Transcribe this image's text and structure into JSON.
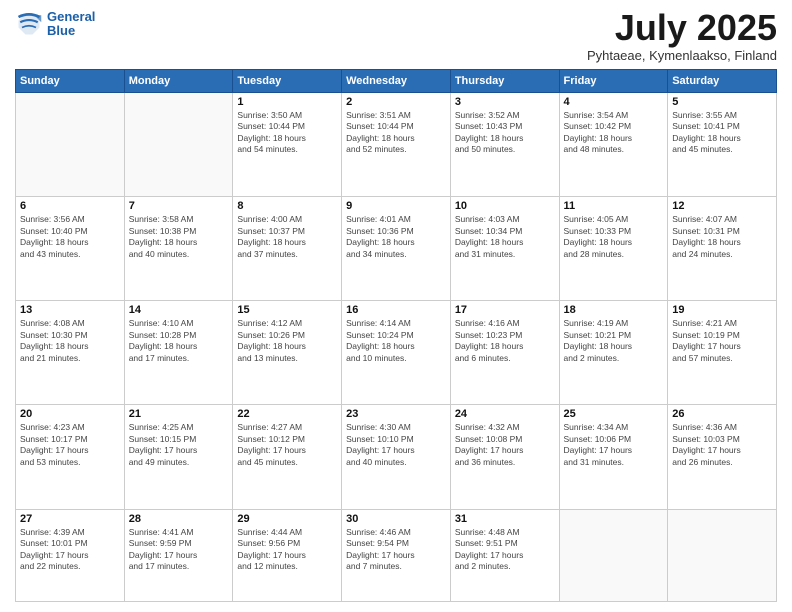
{
  "header": {
    "logo_line1": "General",
    "logo_line2": "Blue",
    "month_title": "July 2025",
    "location": "Pyhtaeae, Kymenlaakso, Finland"
  },
  "weekdays": [
    "Sunday",
    "Monday",
    "Tuesday",
    "Wednesday",
    "Thursday",
    "Friday",
    "Saturday"
  ],
  "weeks": [
    [
      {
        "day": "",
        "info": ""
      },
      {
        "day": "",
        "info": ""
      },
      {
        "day": "1",
        "info": "Sunrise: 3:50 AM\nSunset: 10:44 PM\nDaylight: 18 hours\nand 54 minutes."
      },
      {
        "day": "2",
        "info": "Sunrise: 3:51 AM\nSunset: 10:44 PM\nDaylight: 18 hours\nand 52 minutes."
      },
      {
        "day": "3",
        "info": "Sunrise: 3:52 AM\nSunset: 10:43 PM\nDaylight: 18 hours\nand 50 minutes."
      },
      {
        "day": "4",
        "info": "Sunrise: 3:54 AM\nSunset: 10:42 PM\nDaylight: 18 hours\nand 48 minutes."
      },
      {
        "day": "5",
        "info": "Sunrise: 3:55 AM\nSunset: 10:41 PM\nDaylight: 18 hours\nand 45 minutes."
      }
    ],
    [
      {
        "day": "6",
        "info": "Sunrise: 3:56 AM\nSunset: 10:40 PM\nDaylight: 18 hours\nand 43 minutes."
      },
      {
        "day": "7",
        "info": "Sunrise: 3:58 AM\nSunset: 10:38 PM\nDaylight: 18 hours\nand 40 minutes."
      },
      {
        "day": "8",
        "info": "Sunrise: 4:00 AM\nSunset: 10:37 PM\nDaylight: 18 hours\nand 37 minutes."
      },
      {
        "day": "9",
        "info": "Sunrise: 4:01 AM\nSunset: 10:36 PM\nDaylight: 18 hours\nand 34 minutes."
      },
      {
        "day": "10",
        "info": "Sunrise: 4:03 AM\nSunset: 10:34 PM\nDaylight: 18 hours\nand 31 minutes."
      },
      {
        "day": "11",
        "info": "Sunrise: 4:05 AM\nSunset: 10:33 PM\nDaylight: 18 hours\nand 28 minutes."
      },
      {
        "day": "12",
        "info": "Sunrise: 4:07 AM\nSunset: 10:31 PM\nDaylight: 18 hours\nand 24 minutes."
      }
    ],
    [
      {
        "day": "13",
        "info": "Sunrise: 4:08 AM\nSunset: 10:30 PM\nDaylight: 18 hours\nand 21 minutes."
      },
      {
        "day": "14",
        "info": "Sunrise: 4:10 AM\nSunset: 10:28 PM\nDaylight: 18 hours\nand 17 minutes."
      },
      {
        "day": "15",
        "info": "Sunrise: 4:12 AM\nSunset: 10:26 PM\nDaylight: 18 hours\nand 13 minutes."
      },
      {
        "day": "16",
        "info": "Sunrise: 4:14 AM\nSunset: 10:24 PM\nDaylight: 18 hours\nand 10 minutes."
      },
      {
        "day": "17",
        "info": "Sunrise: 4:16 AM\nSunset: 10:23 PM\nDaylight: 18 hours\nand 6 minutes."
      },
      {
        "day": "18",
        "info": "Sunrise: 4:19 AM\nSunset: 10:21 PM\nDaylight: 18 hours\nand 2 minutes."
      },
      {
        "day": "19",
        "info": "Sunrise: 4:21 AM\nSunset: 10:19 PM\nDaylight: 17 hours\nand 57 minutes."
      }
    ],
    [
      {
        "day": "20",
        "info": "Sunrise: 4:23 AM\nSunset: 10:17 PM\nDaylight: 17 hours\nand 53 minutes."
      },
      {
        "day": "21",
        "info": "Sunrise: 4:25 AM\nSunset: 10:15 PM\nDaylight: 17 hours\nand 49 minutes."
      },
      {
        "day": "22",
        "info": "Sunrise: 4:27 AM\nSunset: 10:12 PM\nDaylight: 17 hours\nand 45 minutes."
      },
      {
        "day": "23",
        "info": "Sunrise: 4:30 AM\nSunset: 10:10 PM\nDaylight: 17 hours\nand 40 minutes."
      },
      {
        "day": "24",
        "info": "Sunrise: 4:32 AM\nSunset: 10:08 PM\nDaylight: 17 hours\nand 36 minutes."
      },
      {
        "day": "25",
        "info": "Sunrise: 4:34 AM\nSunset: 10:06 PM\nDaylight: 17 hours\nand 31 minutes."
      },
      {
        "day": "26",
        "info": "Sunrise: 4:36 AM\nSunset: 10:03 PM\nDaylight: 17 hours\nand 26 minutes."
      }
    ],
    [
      {
        "day": "27",
        "info": "Sunrise: 4:39 AM\nSunset: 10:01 PM\nDaylight: 17 hours\nand 22 minutes."
      },
      {
        "day": "28",
        "info": "Sunrise: 4:41 AM\nSunset: 9:59 PM\nDaylight: 17 hours\nand 17 minutes."
      },
      {
        "day": "29",
        "info": "Sunrise: 4:44 AM\nSunset: 9:56 PM\nDaylight: 17 hours\nand 12 minutes."
      },
      {
        "day": "30",
        "info": "Sunrise: 4:46 AM\nSunset: 9:54 PM\nDaylight: 17 hours\nand 7 minutes."
      },
      {
        "day": "31",
        "info": "Sunrise: 4:48 AM\nSunset: 9:51 PM\nDaylight: 17 hours\nand 2 minutes."
      },
      {
        "day": "",
        "info": ""
      },
      {
        "day": "",
        "info": ""
      }
    ]
  ]
}
